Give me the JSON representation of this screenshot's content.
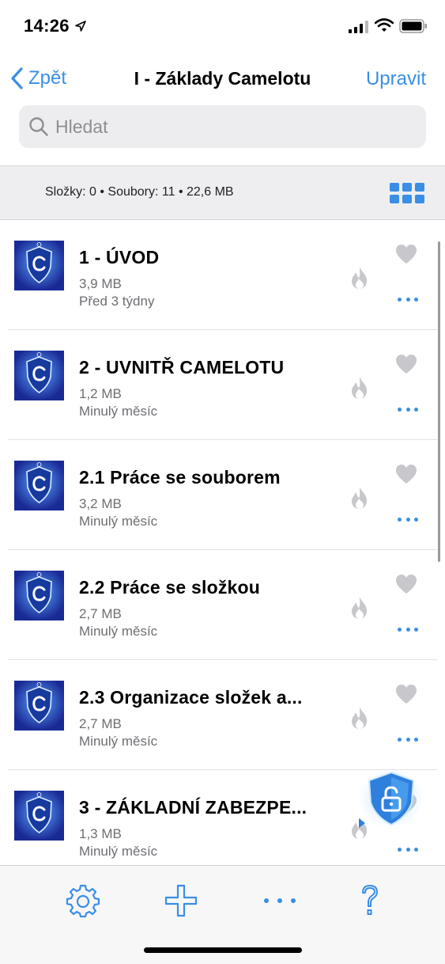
{
  "status": {
    "time": "14:26"
  },
  "nav": {
    "back_label": "Zpět",
    "title": "I - Základy Camelotu",
    "edit_label": "Upravit"
  },
  "search": {
    "placeholder": "Hledat"
  },
  "info": {
    "summary": "Složky: 0 • Soubory: 11 • 22,6 MB"
  },
  "colors": {
    "accent": "#3a8ee6",
    "secondary_text": "#6e6e73",
    "icon_gray": "#c7c7cc"
  },
  "files": [
    {
      "name": "1 - ÚVOD",
      "size": "3,9 MB",
      "date": "Před 3 týdny"
    },
    {
      "name": "2 - UVNITŘ CAMELOTU",
      "size": "1,2 MB",
      "date": "Minulý měsíc"
    },
    {
      "name": "2.1 Práce se souborem",
      "size": "3,2 MB",
      "date": "Minulý měsíc"
    },
    {
      "name": "2.2 Práce se složkou",
      "size": "2,7 MB",
      "date": "Minulý měsíc"
    },
    {
      "name": "2.3 Organizace složek a...",
      "size": "2,7 MB",
      "date": "Minulý měsíc"
    },
    {
      "name": "3 - ZÁKLADNÍ ZABEZPE...",
      "size": "1,3 MB",
      "date": "Minulý měsíc"
    }
  ],
  "tabbar": {
    "icons": [
      "gear-icon",
      "plus-icon",
      "more-icon",
      "help-icon"
    ]
  }
}
